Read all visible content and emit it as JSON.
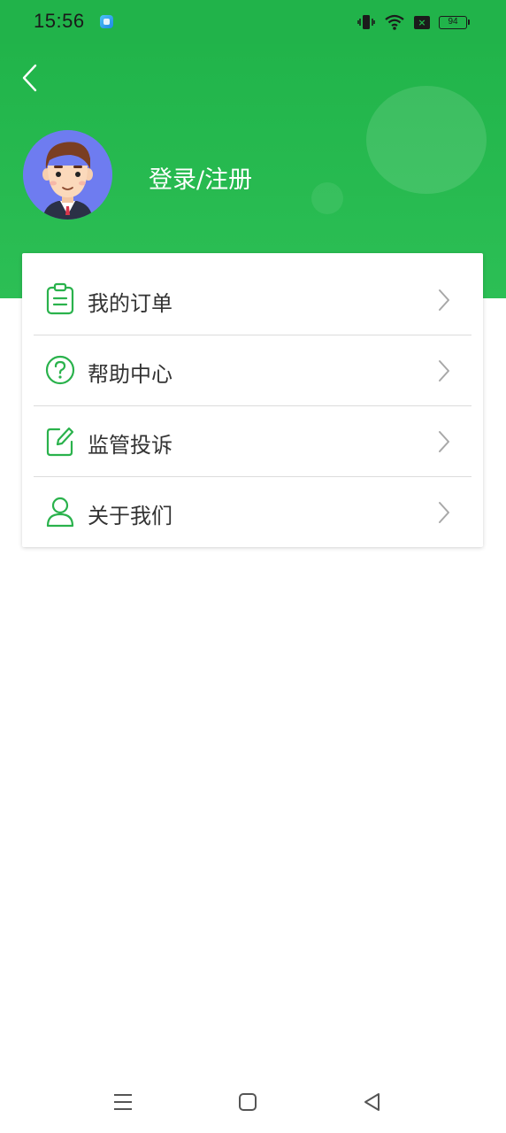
{
  "status_bar": {
    "time": "15:56",
    "battery": "94",
    "icons": [
      "app-icon",
      "vibrate-icon",
      "wifi-icon",
      "sim-icon",
      "battery-icon"
    ]
  },
  "header": {
    "back_icon": "chevron-left-icon",
    "avatar": "avatar-man-illustration",
    "login_label": "登录/注册",
    "accent_color": "#21b34a"
  },
  "menu": {
    "items": [
      {
        "label": "我的订单",
        "icon": "clipboard-icon"
      },
      {
        "label": "帮助中心",
        "icon": "help-circle-icon"
      },
      {
        "label": "监管投诉",
        "icon": "edit-icon"
      },
      {
        "label": "关于我们",
        "icon": "user-icon"
      }
    ],
    "chevron_icon": "chevron-right-icon"
  },
  "nav_bar": {
    "icons": [
      "menu-icon",
      "home-icon",
      "back-icon"
    ]
  }
}
